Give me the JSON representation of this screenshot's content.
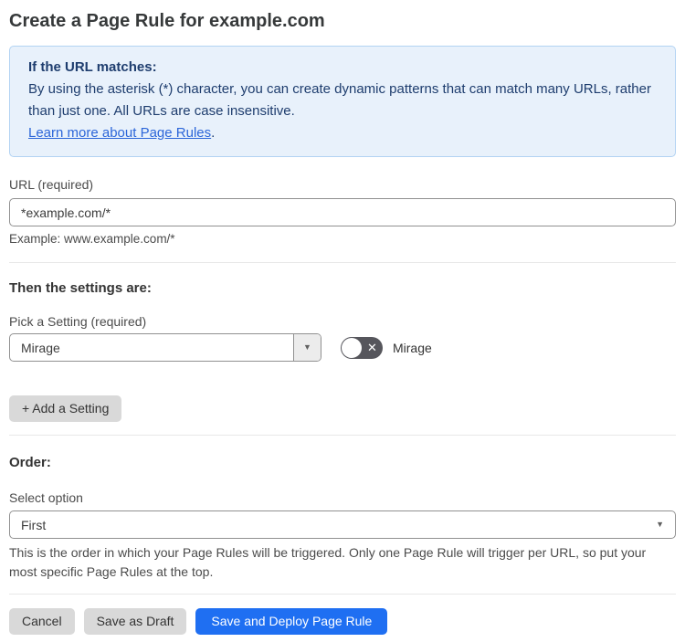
{
  "page": {
    "title": "Create a Page Rule for example.com"
  },
  "info_box": {
    "heading": "If the URL matches:",
    "body": "By using the asterisk (*) character, you can create dynamic patterns that can match many URLs, rather than just one. All URLs are case insensitive.",
    "link_label": "Learn more about Page Rules",
    "link_suffix": "."
  },
  "url_field": {
    "label": "URL (required)",
    "value": "*example.com/*",
    "helper": "Example: www.example.com/*"
  },
  "settings_section": {
    "heading": "Then the settings are:",
    "picker_label": "Pick a Setting (required)",
    "selected_setting": "Mirage",
    "toggle": {
      "label": "Mirage",
      "state": "off"
    },
    "add_setting_label": "+ Add a Setting"
  },
  "order_section": {
    "heading": "Order:",
    "select_label": "Select option",
    "selected_option": "First",
    "helper": "This is the order in which your Page Rules will be triggered. Only one Page Rule will trigger per URL, so put your most specific Page Rules at the top."
  },
  "actions": {
    "cancel_label": "Cancel",
    "save_draft_label": "Save as Draft",
    "save_deploy_label": "Save and Deploy Page Rule"
  },
  "icons": {
    "dropdown_arrow": "▼",
    "toggle_x": "✕"
  },
  "colors": {
    "info_box_bg": "#e8f1fb",
    "info_box_border": "#b3d3f3",
    "info_text": "#1e3d6e",
    "link": "#2c66d9",
    "primary_button_bg": "#1f6ff2",
    "secondary_button_bg": "#d9d9d9",
    "toggle_off_bg": "#56565c",
    "input_border": "#919191",
    "divider": "#e8e8e8"
  }
}
